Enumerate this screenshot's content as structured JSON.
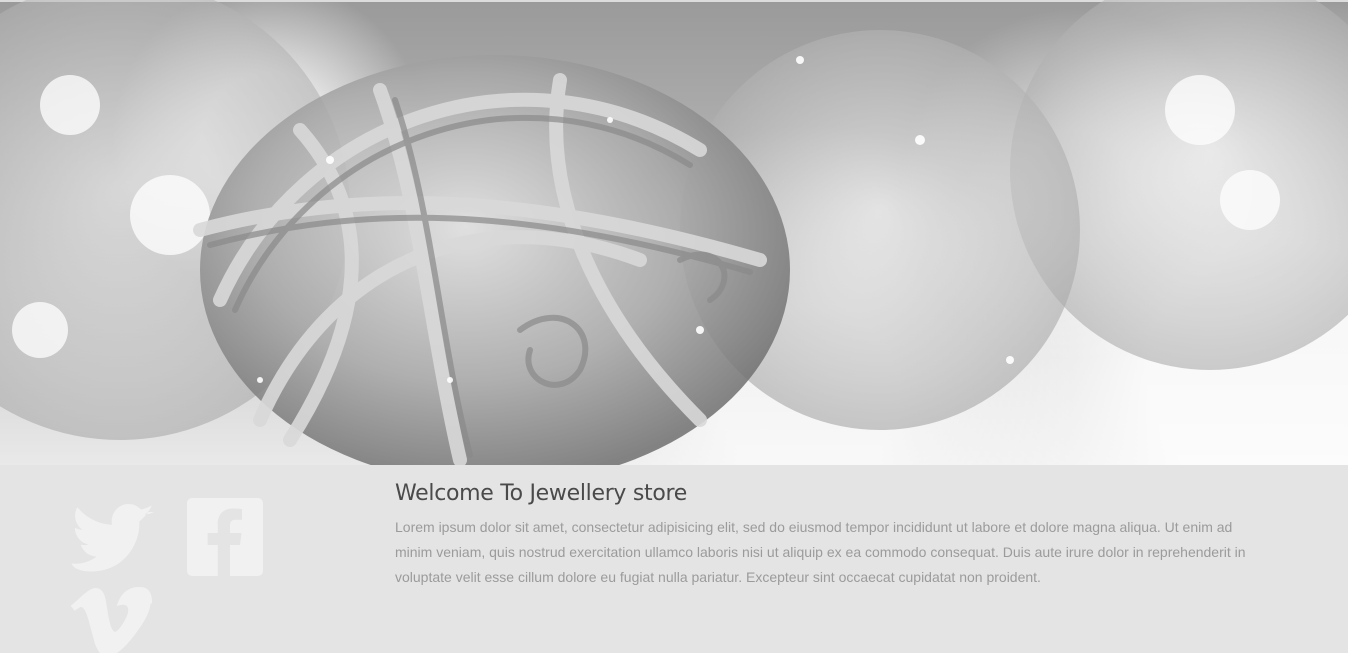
{
  "hero": {
    "image": "silver-glitter-ornament-banner"
  },
  "social": {
    "icons": [
      "twitter-icon",
      "facebook-icon",
      "vimeo-icon"
    ],
    "icon_color": "#f1f1f1"
  },
  "welcome": {
    "title": "Welcome To Jewellery store",
    "body": "Lorem ipsum dolor sit amet, consectetur adipisicing elit, sed do eiusmod tempor incididunt ut labore et dolore magna aliqua. Ut enim ad minim veniam, quis nostrud exercitation ullamco laboris nisi ut aliquip ex ea commodo consequat. Duis aute irure dolor in reprehenderit in voluptate velit esse cillum dolore eu fugiat nulla pariatur. Excepteur sint occaecat cupidatat non proident."
  },
  "colors": {
    "background": "#e4e4e4",
    "title": "#4a4a4a",
    "body_text": "#9b9b9b"
  }
}
